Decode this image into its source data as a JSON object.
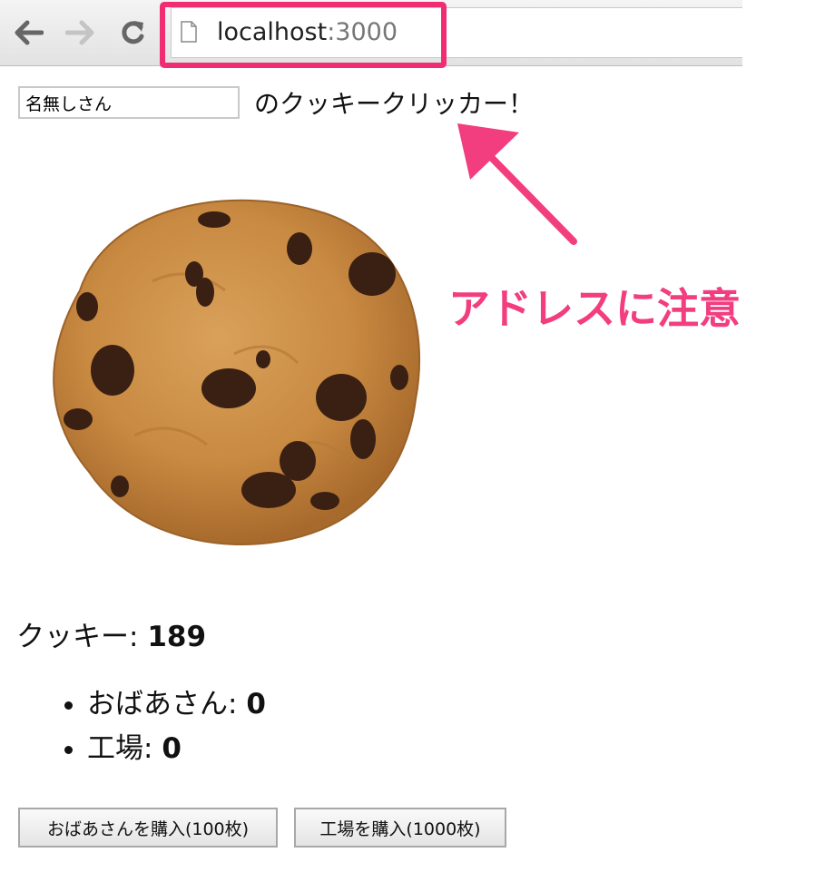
{
  "browser": {
    "url_host": "localhost",
    "url_port": ":3000"
  },
  "annotation": {
    "text": "アドレスに注意",
    "color": "#f23d7e"
  },
  "header": {
    "name_value": "名無しさん",
    "title_suffix": "のクッキークリッカー！"
  },
  "stats": {
    "cookie_label": "クッキー: ",
    "cookie_count": "189",
    "items": [
      {
        "label": "おばあさん: ",
        "count": "0"
      },
      {
        "label": "工場: ",
        "count": "0"
      }
    ]
  },
  "actions": {
    "buy_grandma": "おばあさんを購入(100枚)",
    "buy_factory": "工場を購入(1000枚)"
  },
  "icons": {
    "back": "arrow-left-icon",
    "forward": "arrow-right-icon",
    "reload": "reload-icon",
    "page": "page-icon",
    "cookie": "cookie-image"
  }
}
